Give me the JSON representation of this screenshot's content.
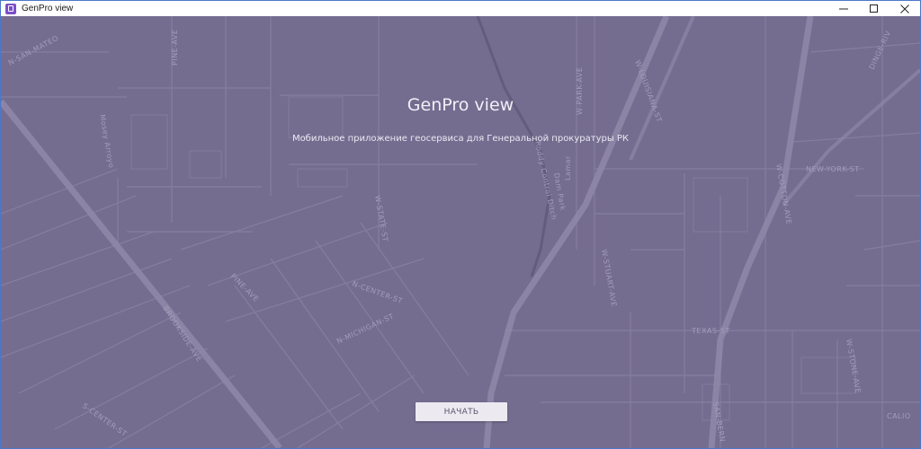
{
  "window": {
    "title": "GenPro view",
    "icon": "app-logo-icon",
    "controls": [
      "minimize-icon",
      "maximize-icon",
      "close-icon"
    ]
  },
  "main": {
    "title": "GenPro view",
    "subtitle": "Мобильное приложение геосервиса для Генеральной прокуратуры РК",
    "start_button_label": "НАЧАТЬ"
  },
  "map": {
    "streets": {
      "s1": "N-SAN-MATEO",
      "s2": "PINE-AVE",
      "s3": "Mosey Arroyo",
      "s4": "W-PARK-AVE",
      "s5": "W-LOUISIANA-ST",
      "s6": "DINGE-RIV",
      "s7": "Dam Park",
      "s8": "Roddy Control Ditch",
      "s9": "Lamar",
      "s10": "NEW-YORK-ST",
      "s11": "W-COTTON-AVE",
      "s12": "W-STATE-ST",
      "s13": "W-STUART-AVE",
      "s14": "N-CENTER-ST",
      "s15": "N-MICHIGAN-ST",
      "s16": "BROOKSIDE-AVE",
      "s17": "TEXAS-ST",
      "s18": "W-STONE-AVE",
      "s19": "S-CENTER-ST",
      "s20": "SAN-BERN",
      "s21": "CALIO"
    },
    "colors": {
      "background": "#756d90",
      "road": "#8a83a3",
      "major_road": "#928bab",
      "rail": "#5e5778"
    }
  }
}
